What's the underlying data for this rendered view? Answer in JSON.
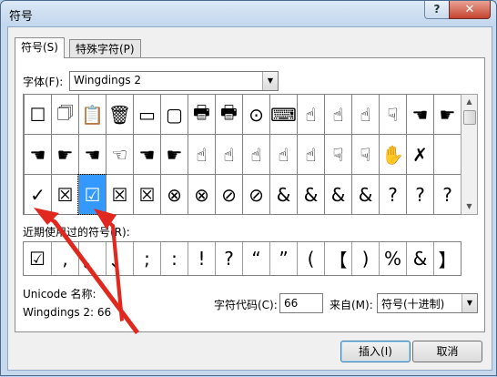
{
  "window": {
    "title": "符号",
    "help": "?",
    "close": "✕"
  },
  "tabs": [
    {
      "label": "符号(S)"
    },
    {
      "label": "特殊字符(P)"
    }
  ],
  "font": {
    "label": "字体(F):",
    "value": "Wingdings 2"
  },
  "grid": {
    "rows": [
      [
        "",
        "✎",
        "✎",
        "✒",
        "✏",
        "✄",
        "✂",
        "☎",
        "☏",
        "🗋",
        "☐",
        "🗍",
        "🗎",
        "🗏",
        "🗐",
        "🗋"
      ],
      [
        "☐",
        "🗐",
        "📋",
        "🗑",
        "▭",
        "▢",
        "🖶",
        "🖶",
        "⊙",
        "📼",
        "✍",
        "✍",
        "👍",
        "👎",
        "☚",
        "☛"
      ],
      [
        "☚",
        "☛",
        "☚",
        "☜",
        "☚",
        "☛",
        "☝",
        "☟",
        "☝",
        "☝",
        "☝",
        "☟",
        "☝",
        "✋",
        "✗",
        ""
      ],
      [
        "✓",
        "☒",
        "☑",
        "☒",
        "☒",
        "⊗",
        "⊗",
        "⊘",
        "⊘",
        "&",
        "&",
        "&",
        "&",
        "‽",
        "‽",
        "?"
      ]
    ],
    "visible_rows": [
      [
        "",
        "✎",
        "✎",
        "✒",
        "✏",
        "✄",
        "✂",
        "☎",
        "❳",
        "🗋",
        "☐",
        "🗇",
        "🗎",
        "🗐",
        "🗐",
        "🗋"
      ],
      [
        "☐",
        "🗇",
        "📋",
        "🗑",
        "▭",
        "▢",
        "🖶",
        "🖶",
        "⊙",
        "⌨",
        "☝",
        "☝",
        "☝",
        "☟",
        "☚",
        "☛"
      ],
      [
        "☚",
        "☛",
        "☚",
        "☜",
        "☚",
        "☛",
        "☝",
        "☝",
        "☝",
        "☝",
        "☝",
        "☟",
        "☟",
        "✋",
        "✗",
        ""
      ],
      [
        "✓",
        "☒",
        "☑",
        "☒",
        "☒",
        "⊗",
        "⊗",
        "⊘",
        "⊘",
        "&",
        "&",
        "&",
        "&",
        "?",
        "?",
        "?"
      ]
    ],
    "selected_index": 2
  },
  "recent": {
    "label": "近期使用过的符号(R):",
    "items": [
      "☑",
      ",",
      "。",
      "、",
      ";",
      ":",
      "!",
      "?",
      "“",
      "”",
      "(",
      "【",
      ")",
      "%",
      "&",
      "】"
    ]
  },
  "unicode_name": {
    "label": "Unicode 名称:",
    "value": "Wingdings 2: 66"
  },
  "char_code": {
    "label": "字符代码(C):",
    "value": "66"
  },
  "from": {
    "label": "来自(M):",
    "value": "符号(十进制)"
  },
  "buttons": {
    "insert": "插入(I)",
    "cancel": "取消"
  },
  "colors": {
    "selection": "#3399ff",
    "arrow": "#e0281e"
  }
}
